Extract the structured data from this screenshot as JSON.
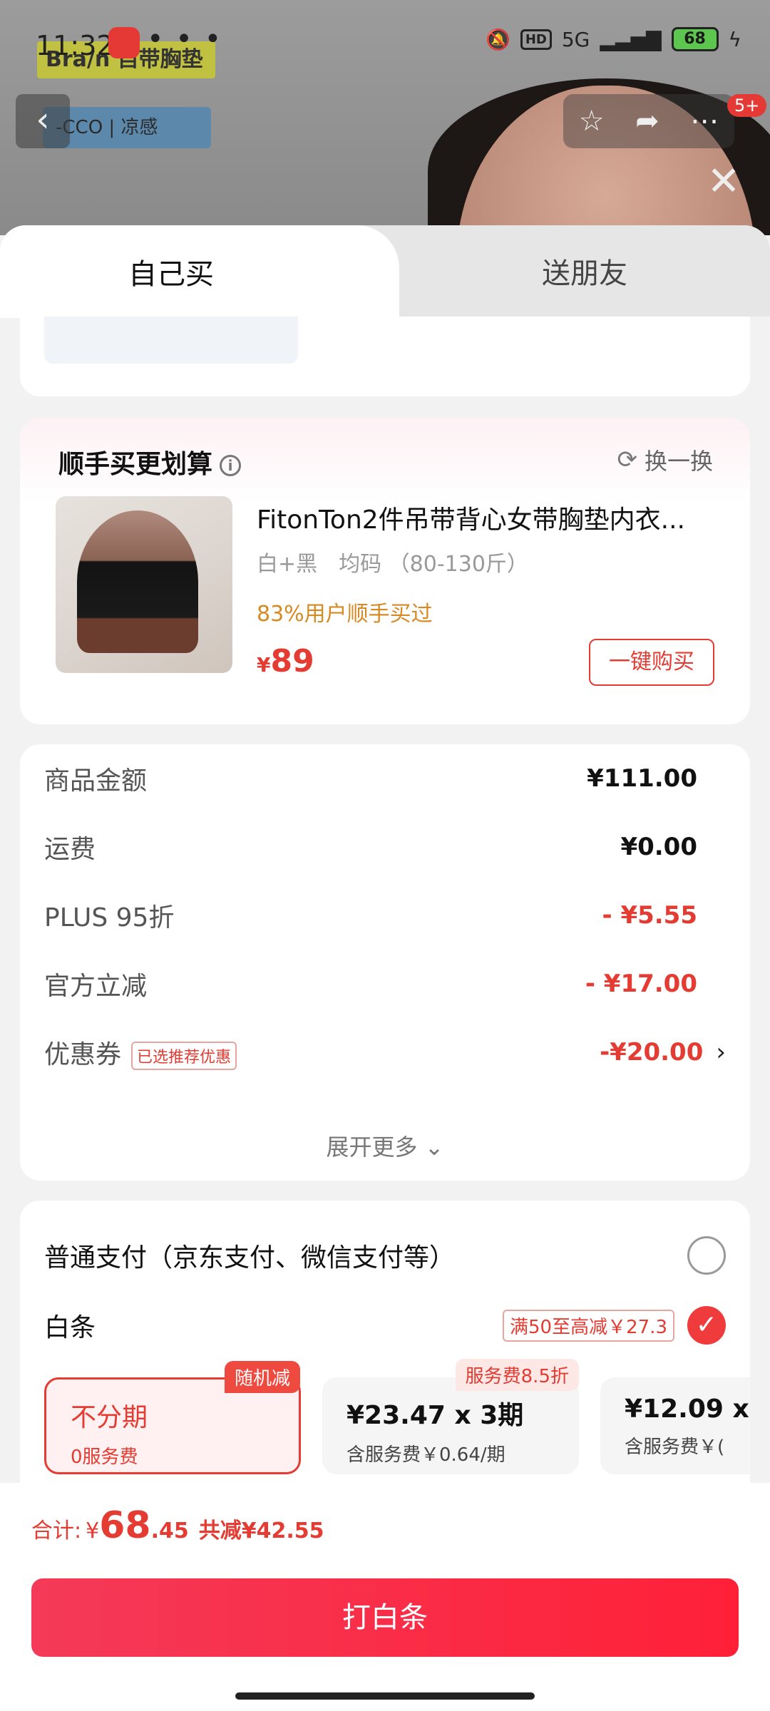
{
  "status": {
    "time": "11:32",
    "more": "• • •",
    "hd": "HD",
    "network": "5G",
    "battery": "68"
  },
  "bg": {
    "banner1": "Bra/n 自带胸垫",
    "banner2": "-CCO | 凉感",
    "badge": "5+"
  },
  "tabs": {
    "self": "自己买",
    "friend": "送朋友"
  },
  "bundle": {
    "title": "顺手买更划算",
    "swap": "换一换",
    "product": {
      "name": "FitonTon2件吊带背心女带胸垫内衣...",
      "spec": "白+黑　均码 （80-130斤）",
      "bought": "83%用户顺手买过",
      "currency": "¥",
      "price": "89",
      "buy": "一键购买"
    }
  },
  "price": {
    "rows": [
      {
        "label": "商品金额",
        "value": "¥111.00"
      },
      {
        "label": "运费",
        "value": "¥0.00"
      },
      {
        "label": "PLUS 95折",
        "value": "- ¥5.55"
      },
      {
        "label": "官方立减",
        "value": "- ¥17.00"
      },
      {
        "label": "优惠券",
        "tag": "已选推荐优惠",
        "value": "-¥20.00"
      }
    ],
    "expand": "展开更多 ⌄"
  },
  "payment": {
    "normal": "普通支付（京东支付、微信支付等）",
    "baitiao": "白条",
    "baitiao_promo": "满50至高减￥27.3",
    "options": [
      {
        "main": "不分期",
        "sub": "0服务费",
        "tag": "随机减"
      },
      {
        "main": "¥23.47 x 3期",
        "sub": "含服务费￥0.64/期",
        "tag": "服务费8.5折"
      },
      {
        "main": "¥12.09 x",
        "sub": "含服务费￥("
      }
    ]
  },
  "footer": {
    "label": "合计:",
    "currency": "¥",
    "amount_int": "68",
    "amount_dec": ".45",
    "savings": "共减¥42.55",
    "pay_button": "打白条"
  }
}
